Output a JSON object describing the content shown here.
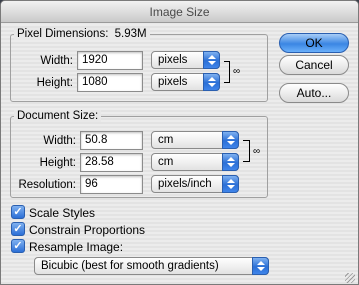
{
  "window": {
    "title": "Image Size"
  },
  "pixel_dimensions": {
    "title": "Pixel Dimensions:",
    "size": "5.93M",
    "width_label": "Width:",
    "width_value": "1920",
    "width_unit": "pixels",
    "height_label": "Height:",
    "height_value": "1080",
    "height_unit": "pixels"
  },
  "document_size": {
    "title": "Document Size:",
    "width_label": "Width:",
    "width_value": "50.8",
    "width_unit": "cm",
    "height_label": "Height:",
    "height_value": "28.58",
    "height_unit": "cm",
    "resolution_label": "Resolution:",
    "resolution_value": "96",
    "resolution_unit": "pixels/inch"
  },
  "buttons": {
    "ok": "OK",
    "cancel": "Cancel",
    "auto": "Auto..."
  },
  "options": {
    "scale_styles": "Scale Styles",
    "constrain_proportions": "Constrain Proportions",
    "resample_image": "Resample Image:",
    "resample_method": "Bicubic (best for smooth gradients)"
  },
  "icons": {
    "chain": "chain-link-icon",
    "checkmark": "checkmark-icon",
    "popup_arrows": "popup-arrows-icon"
  },
  "colors": {
    "accent_blue": "#3b86e3",
    "dialog_bg": "#e8e8e8"
  }
}
